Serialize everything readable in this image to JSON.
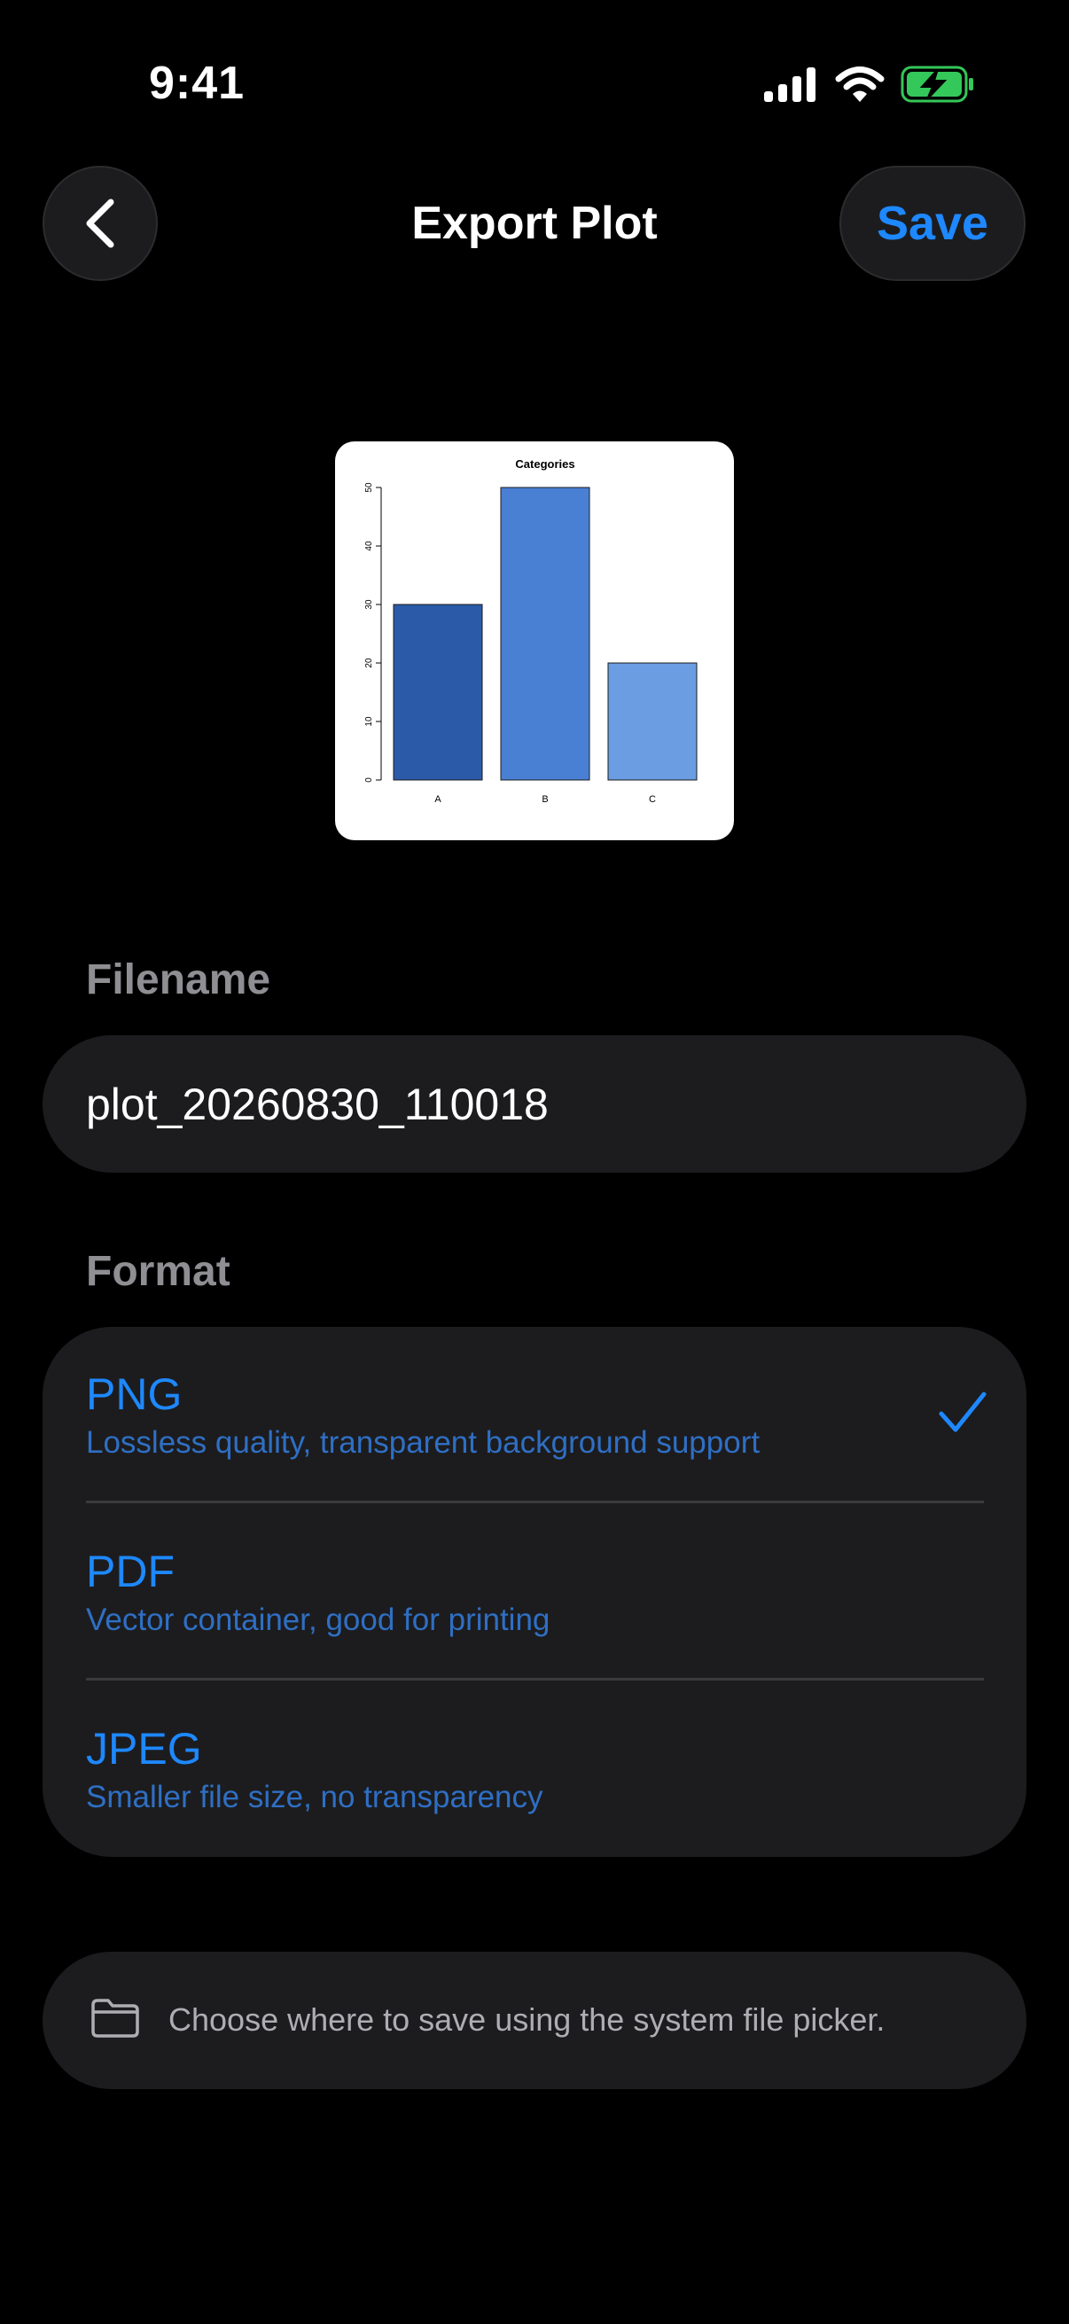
{
  "status_bar": {
    "time": "9:41",
    "icons": [
      "cellular-signal-icon",
      "wifi-icon",
      "battery-charging-icon"
    ],
    "battery_color": "#34c759"
  },
  "header": {
    "back_icon": "chevron-left-icon",
    "title": "Export Plot",
    "save_label": "Save"
  },
  "preview": {
    "chart_data": {
      "type": "bar",
      "title": "Categories",
      "categories": [
        "A",
        "B",
        "C"
      ],
      "values": [
        30,
        50,
        20
      ],
      "colors": [
        "#2b5aa8",
        "#4a80d4",
        "#6b9de3"
      ],
      "ylim": [
        0,
        50
      ],
      "yticks": [
        "0",
        "10",
        "20",
        "30",
        "40",
        "50"
      ],
      "xlabel": "",
      "ylabel": "",
      "grid": false
    }
  },
  "filename": {
    "label": "Filename",
    "value": "plot_20260830_110018"
  },
  "format": {
    "label": "Format",
    "options": [
      {
        "name": "PNG",
        "description": "Lossless quality, transparent background support",
        "selected": true
      },
      {
        "name": "PDF",
        "description": "Vector container, good for printing",
        "selected": false
      },
      {
        "name": "JPEG",
        "description": "Smaller file size, no transparency",
        "selected": false
      }
    ],
    "check_icon": "checkmark-icon"
  },
  "info": {
    "icon": "folder-icon",
    "text": "Choose where to save using the system file picker."
  },
  "colors": {
    "accent": "#1e88ff",
    "card_background": "#1c1c1e",
    "secondary_text": "#8e8e93"
  }
}
